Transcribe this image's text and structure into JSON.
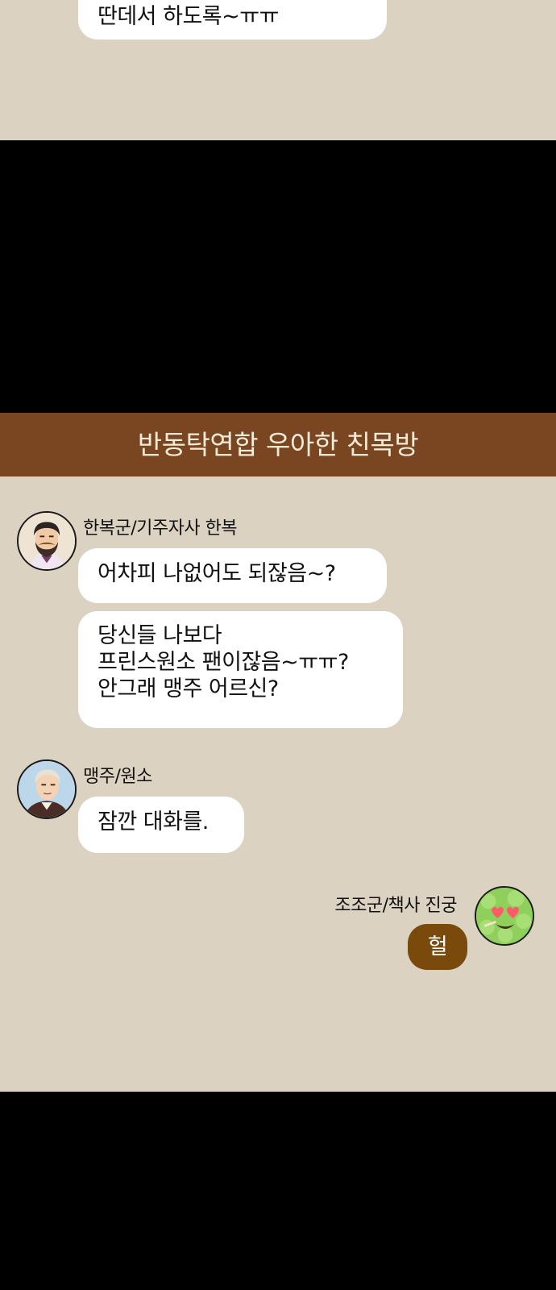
{
  "top_panel": {
    "bubble_text": "딴데서 하도록~ㅠㅠ"
  },
  "chat": {
    "title": "반동탁연합 우아한 친목방",
    "colors": {
      "background": "#dcd2c1",
      "header": "#7a4622",
      "my_bubble": "#7a4a0c",
      "other_bubble": "#ffffff"
    },
    "messages": [
      {
        "sender": "한복군/기주자사 한복",
        "avatar": "bearded-man-avatar-icon",
        "bubbles": [
          "어차피 나없어도 되잖음~?",
          "당신들 나보다\n프린스원소 팬이잖음~ㅠㅠ?\n안그래 맹주 어르신?"
        ]
      },
      {
        "sender": "맹주/원소",
        "avatar": "gentleman-avatar-icon",
        "bubbles": [
          "잠깐 대화를."
        ]
      },
      {
        "sender": "조조군/책사 진궁",
        "avatar": "green-heart-eyes-avatar-icon",
        "bubbles": [
          "헐"
        ]
      }
    ]
  }
}
